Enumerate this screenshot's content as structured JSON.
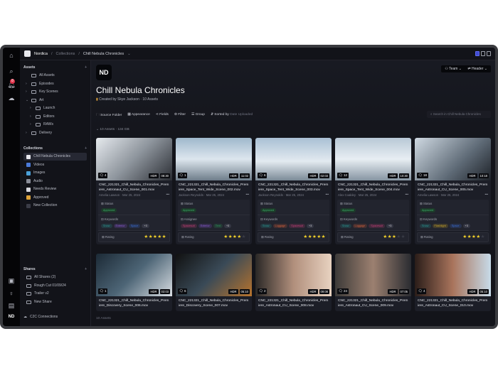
{
  "topbar": {
    "workspace": "Nordica",
    "crumb": "Collections",
    "current": "Chill Nebula Chronicles",
    "view_toggle_active": 0
  },
  "rail": {
    "notification_count": "8",
    "avatar": "ND"
  },
  "sidebar": {
    "assets_title": "Assets",
    "assets": [
      {
        "label": "All Assets",
        "depth": 0,
        "chev": ""
      },
      {
        "label": "Episodes",
        "depth": 0,
        "chev": "›"
      },
      {
        "label": "Key Scenes",
        "depth": 0,
        "chev": "›"
      },
      {
        "label": "Art",
        "depth": 0,
        "chev": "⌄"
      },
      {
        "label": "Launch",
        "depth": 1,
        "chev": "›"
      },
      {
        "label": "Editors",
        "depth": 1,
        "chev": "›"
      },
      {
        "label": "RAWs",
        "depth": 1,
        "chev": "›"
      },
      {
        "label": "Delivery",
        "depth": 0,
        "chev": "›"
      }
    ],
    "collections_title": "Collections",
    "collections": [
      {
        "label": "Chill Nebula Chronicles",
        "color": "#e8e8ee",
        "selected": true
      },
      {
        "label": "Videos",
        "color": "#4b7bd9"
      },
      {
        "label": "Images",
        "color": "#4aa0d8"
      },
      {
        "label": "Audio",
        "color": "#8a8d99"
      },
      {
        "label": "Needs Review",
        "color": "#d8d9e0"
      },
      {
        "label": "Approved",
        "color": "#e0a43a"
      },
      {
        "label": "New Collection",
        "color": "#3a3c47"
      }
    ],
    "shares_title": "Shares",
    "shares": [
      "All Shares (2)",
      "Rough Cut 01/09/24",
      "Trailer v2",
      "New Share"
    ],
    "c2c": "C2C Connections"
  },
  "header": {
    "logo": "ND",
    "title": "Chill Nebula Chronicles",
    "created_by": "Created by Skye Jackson",
    "asset_count": "10 Assets",
    "team_button": "Team",
    "header_button": "Header"
  },
  "toolbar": {
    "source_folder": "Source Folder",
    "appearance": "Appearance",
    "fields": "Fields",
    "filter": "Filter",
    "group": "Group",
    "sorted_by": "Sorted by",
    "sort_value": "Date Uploaded",
    "search_placeholder": "Search in Chill Nebula Chronicles"
  },
  "group_summary": {
    "count": "10 Assets",
    "size": "134 GB"
  },
  "footer_count": "10 Assets",
  "assets": [
    {
      "name": "CNC_221321_Chill_Nebula_Chronicles_Premiere_Astronaut_CU_Scene_001.mov",
      "author": "Amelia Lawson",
      "date": "Mar 25, 2024",
      "comments": "4",
      "hdr": "HDR",
      "duration": "08:30",
      "status": "Approved",
      "field2": "Keywords",
      "tags": [
        [
          "Snow",
          "#2a9b95"
        ],
        [
          "Exterior",
          "#8b5cd6"
        ],
        [
          "Space",
          "#3b6fd6"
        ]
      ],
      "more": "+3",
      "rating": 5
    },
    {
      "name": "CNC_221321_Chill_Nebula_Chronicles_Premiere_Space_Tent_Wide_Scene_002.mov",
      "author": "Jackson Reynolds",
      "date": "Mar 25, 2024",
      "comments": "1",
      "hdr": "HDR",
      "duration": "11:02",
      "status": "Approved",
      "field2": "Assignee",
      "tags": [
        [
          "Spacesuit",
          "#c6407a"
        ],
        [
          "Exterior",
          "#8b5cd6"
        ],
        [
          "Tent",
          "#2f9a5a"
        ]
      ],
      "more": "+3",
      "rating": 4
    },
    {
      "name": "CNC_221321_Chill_Nebula_Chronicles_Premiere_Space_Tent_Wide_Scene_003.mov",
      "author": "Jackson Reynolds",
      "date": "Mar 25, 2024",
      "comments": "6",
      "hdr": "HDR",
      "duration": "02:03",
      "status": "Approved",
      "field2": "Keywords",
      "tags": [
        [
          "Snow",
          "#2a9b95"
        ],
        [
          "Luggage",
          "#d0603a"
        ],
        [
          "Spacesuit",
          "#c6407a"
        ]
      ],
      "more": "+3",
      "rating": 5
    },
    {
      "name": "CNC_221321_Chill_Nebula_Chronicles_Premiere_Space_Tent_Wide_Scene_004.mov",
      "author": "Alex Coakley",
      "date": "Mar 25, 2024",
      "comments": "12",
      "hdr": "HDR",
      "duration": "10:30",
      "status": "Approved",
      "field2": "Keywords",
      "tags": [
        [
          "Snow",
          "#2a9b95"
        ],
        [
          "Luggage",
          "#d0603a"
        ],
        [
          "Spacesuit",
          "#c6407a"
        ]
      ],
      "more": "+3",
      "rating": 3
    },
    {
      "name": "CNC_221321_Chill_Nebula_Chronicles_Premiere_Astronaut_CU_Scene_005.mov",
      "author": "Amelia Lawson",
      "date": "Mar 25, 2024",
      "comments": "18",
      "hdr": "HDR",
      "duration": "10:18",
      "status": "Approved",
      "field2": "Keywords",
      "tags": [
        [
          "Snow",
          "#2a9b95"
        ],
        [
          "Flashlight",
          "#c9a52a"
        ],
        [
          "Space",
          "#3b6fd6"
        ]
      ],
      "more": "+3",
      "rating": 4
    },
    {
      "name": "CNC_221321_Chill_Nebula_Chronicles_Premiere_Discovery_Scene_006.mov",
      "comments": "1",
      "hdr": "HDR",
      "duration": "03:03"
    },
    {
      "name": "CNC_221321_Chill_Nebula_Chronicles_Premiere_Discovery_Scene_007.mov",
      "comments": "6",
      "hdr": "HDR",
      "duration": "05:10"
    },
    {
      "name": "CNC_221321_Chill_Nebula_Chronicles_Premiere_Astronaut_CU_Scene_008.mov",
      "comments": "2",
      "hdr": "HDR",
      "duration": "09:08"
    },
    {
      "name": "CNC_221321_Chill_Nebula_Chronicles_Premiere_Astronaut_CU_Scene_009.mov",
      "comments": "24",
      "hdr": "HDR",
      "duration": "07:05"
    },
    {
      "name": "CNC_221321_Chill_Nebula_Chronicles_Premiere_Astronaut_CU_Scene_010.mov",
      "comments": "4",
      "hdr": "HDR",
      "duration": "05:10"
    }
  ],
  "field_labels": {
    "status": "Status",
    "rating": "Rating"
  },
  "colors": {
    "accent": "#3f4bd1",
    "approved": "#3bb36a",
    "star": "#f5d32a"
  }
}
